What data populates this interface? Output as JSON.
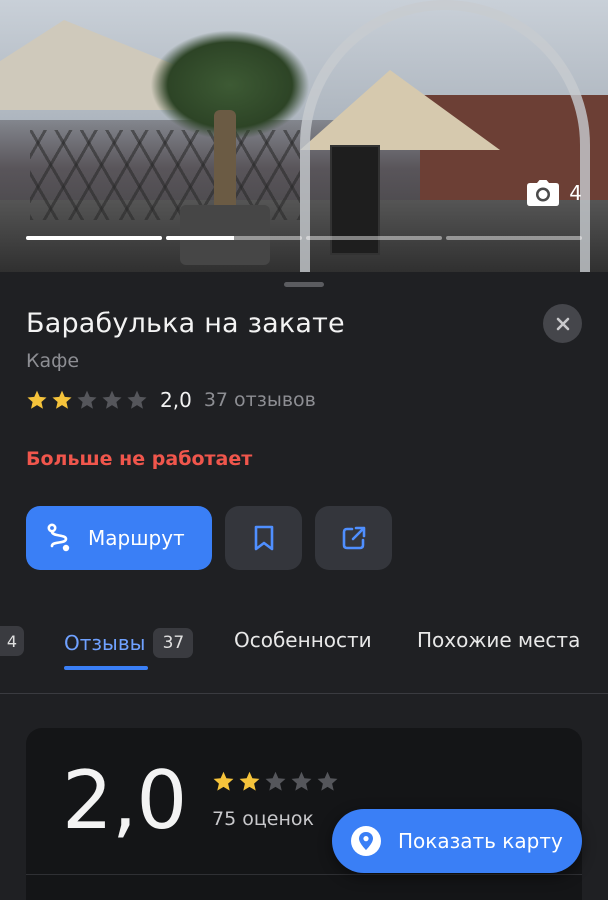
{
  "photo": {
    "count": "4",
    "progress": [
      1,
      0.5,
      0,
      0
    ]
  },
  "place": {
    "name": "Барабулька на закате",
    "category": "Кафе",
    "rating": "2,0",
    "rating_stars": 2,
    "reviews_count": "37 отзывов",
    "status": "Больше не работает"
  },
  "actions": {
    "route_label": "Маршрут"
  },
  "tabs": {
    "cut_badge": "4",
    "reviews_label": "Отзывы",
    "reviews_badge": "37",
    "features_label": "Особенности",
    "similar_label": "Похожие места"
  },
  "summary": {
    "rating": "2,0",
    "stars": 2,
    "ratings_count": "75 оценок"
  },
  "map_button": {
    "label": "Показать карту"
  },
  "colors": {
    "accent": "#3a7ff6",
    "star_filled": "#f5c33b",
    "star_empty": "#55565b",
    "closed_status": "#f0564c"
  }
}
